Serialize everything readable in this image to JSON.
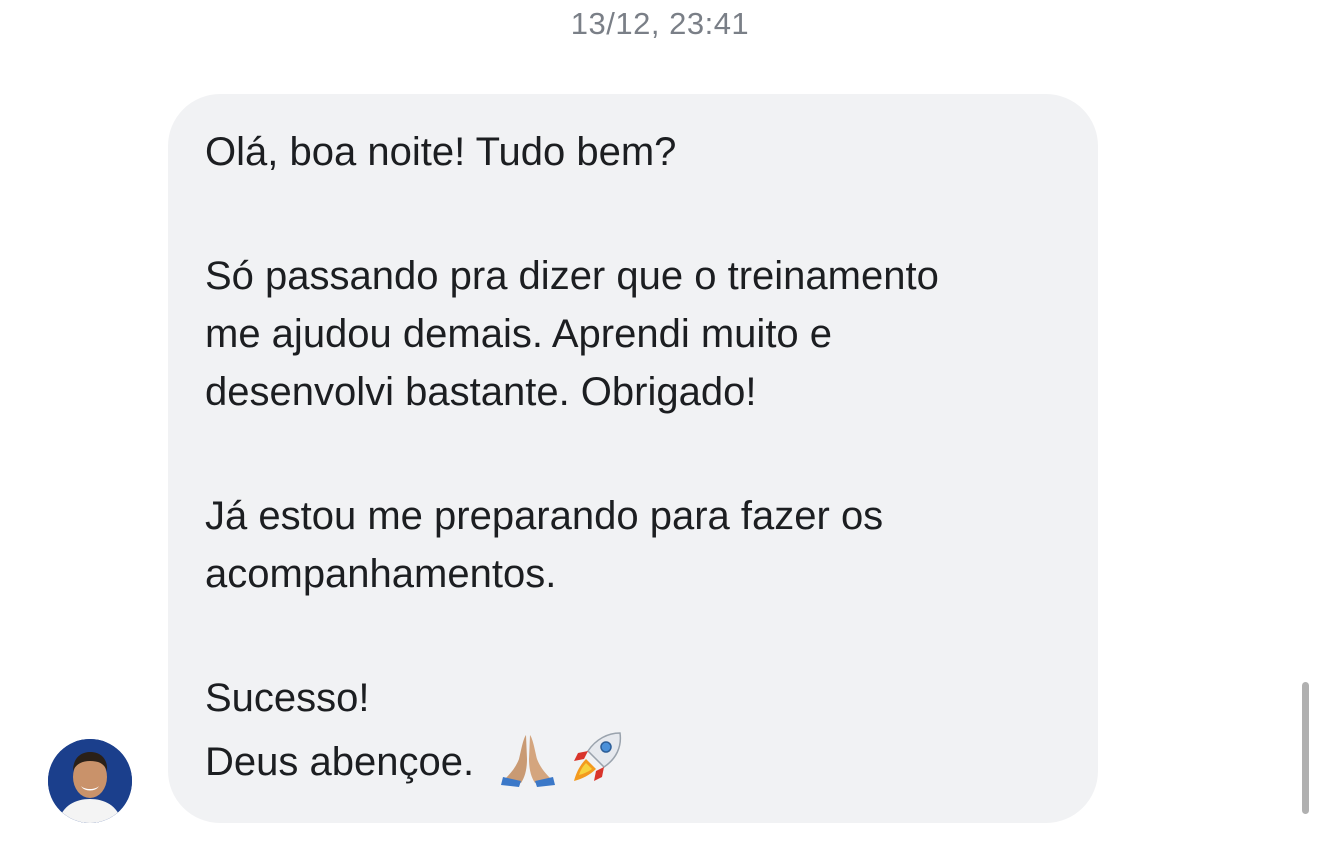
{
  "conversation": {
    "timestamp": "13/12, 23:41"
  },
  "message": {
    "lines": [
      "Olá, boa noite! Tudo bem?",
      "Só passando pra dizer que o treinamento",
      "me ajudou demais. Aprendi muito e",
      "desenvolvi bastante. Obrigado!",
      "Já estou me preparando para fazer os",
      "acompanhamentos.",
      "Sucesso!",
      "Deus abençoe."
    ],
    "emojis": [
      "praying-hands",
      "rocket"
    ]
  },
  "colors": {
    "bubble_background": "#f1f2f4",
    "text": "#1c1e21",
    "timestamp_text": "#7a7f87",
    "avatar_background": "#1b3f8c"
  }
}
